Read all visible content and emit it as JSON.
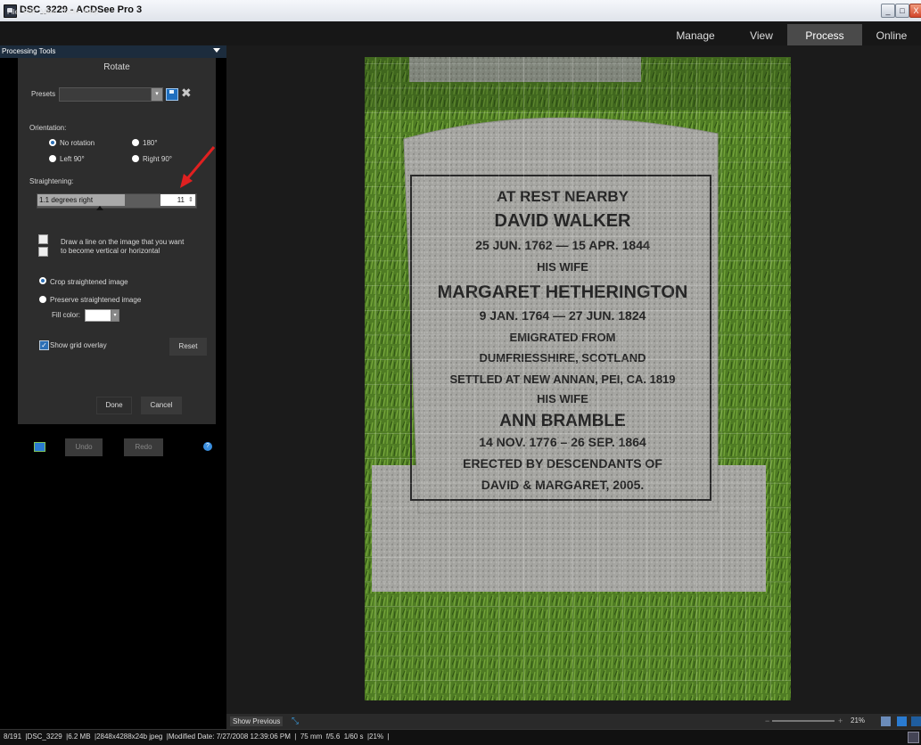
{
  "window": {
    "title": "DSC_3229 - ACDSee Pro 3",
    "min": "_",
    "max": "□",
    "close": "X"
  },
  "menu": {
    "items": [
      "File",
      "Edit",
      "View",
      "Tools",
      "Help"
    ]
  },
  "modes": {
    "manage": "Manage",
    "view": "View",
    "process": "Process",
    "online": "Online",
    "active": "Process"
  },
  "panel": {
    "header": "Processing Tools",
    "title": "Rotate",
    "presets_label": "Presets",
    "presets_value": "",
    "orientation_label": "Orientation:",
    "orientation_options": [
      "No rotation",
      "180°",
      "Left 90°",
      "Right 90°"
    ],
    "orientation_selected": "No rotation",
    "straightening_label": "Straightening:",
    "straightening_text": "1.1 degrees right",
    "straightening_value": "11",
    "straightening_fraction": 0.55,
    "draw_line_hint_1": "Draw a line on the image that you want",
    "draw_line_hint_2": "to become vertical or horizontal",
    "crop_option": "Crop straightened image",
    "preserve_option": "Preserve straightened image",
    "fill_color_label": "Fill color:",
    "fill_color": "#ffffff",
    "show_grid_label": "Show grid overlay",
    "show_grid_checked": true,
    "reset_label": "Reset",
    "done_label": "Done",
    "cancel_label": "Cancel",
    "undo_label": "Undo",
    "redo_label": "Redo"
  },
  "headstone": {
    "lines": [
      "AT REST NEARBY",
      "DAVID WALKER",
      "25 JUN. 1762  —  15 APR. 1844",
      "HIS WIFE",
      "MARGARET HETHERINGTON",
      "9 JAN. 1764   —  27 JUN. 1824",
      "EMIGRATED FROM",
      "DUMFRIESSHIRE, SCOTLAND",
      "SETTLED AT NEW ANNAN, PEI, CA. 1819",
      "HIS WIFE",
      "ANN BRAMBLE",
      "14 NOV. 1776 – 26 SEP. 1864",
      "ERECTED BY DESCENDANTS OF",
      "DAVID & MARGARET, 2005."
    ]
  },
  "viewer_bar": {
    "show_previous": "Show Previous",
    "zoom": "21%"
  },
  "status": {
    "text": "8/191  |DSC_3229  |6.2 MB  |2848x4288x24b jpeg  |Modified Date: 7/27/2008 12:39:06 PM  |  75 mm  f/5.6  1/60 s  |21%  |"
  },
  "colors": {
    "accent": "#2c6fb5",
    "panel": "#2d2d2d",
    "annotation": "#e02020"
  }
}
